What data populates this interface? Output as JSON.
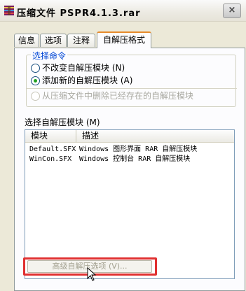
{
  "window": {
    "title": "压缩文件 PSPR4.1.3.rar",
    "close_label": "×"
  },
  "tabs": [
    {
      "label": "信息",
      "active": false
    },
    {
      "label": "选项",
      "active": false
    },
    {
      "label": "注释",
      "active": false
    },
    {
      "label": "自解压格式",
      "active": true
    }
  ],
  "command_group": {
    "title": "选择命令",
    "options": [
      {
        "label": "不改变自解压模块 (N)",
        "checked": false,
        "enabled": true
      },
      {
        "label": "添加新的自解压模块 (A)",
        "checked": true,
        "enabled": true
      },
      {
        "label": "从压缩文件中删除已经存在的自解压模块",
        "checked": false,
        "enabled": false
      }
    ]
  },
  "module_list": {
    "label": "选择自解压模块 (M)",
    "columns": [
      "模块",
      "描述"
    ],
    "rows": [
      {
        "module": "Default.SFX",
        "description": "Windows 图形界面 RAR 自解压模块"
      },
      {
        "module": "WinCon.SFX",
        "description": "Windows 控制台 RAR 自解压模块"
      }
    ]
  },
  "advanced_button": {
    "label": "高级自解压选项 (V)...",
    "enabled": false
  },
  "colors": {
    "group_title": "#0046d5",
    "active_tab_accent": "#e68b2c",
    "highlight_box": "#e03030",
    "radio_checked": "#21a121"
  }
}
